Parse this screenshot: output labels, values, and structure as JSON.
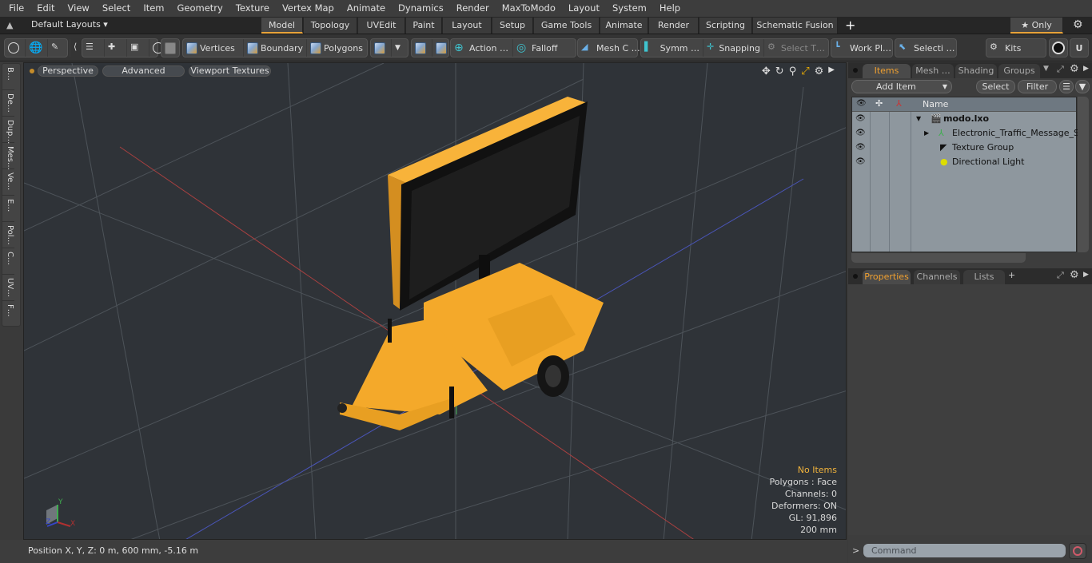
{
  "menu": [
    "File",
    "Edit",
    "View",
    "Select",
    "Item",
    "Geometry",
    "Texture",
    "Vertex Map",
    "Animate",
    "Dynamics",
    "Render",
    "MaxToModo",
    "Layout",
    "System",
    "Help"
  ],
  "layouts": {
    "label": "Default Layouts ▾",
    "tabs": [
      "Model",
      "Topology",
      "UVEdit",
      "Paint",
      "Layout",
      "Setup",
      "Game Tools",
      "Animate",
      "Render",
      "Scripting",
      "Schematic Fusion"
    ],
    "active": "Model",
    "add": "+",
    "only": "★ Only"
  },
  "toolbar": {
    "vertices": "Vertices",
    "boundary": "Boundary",
    "polygons": "Polygons",
    "action": "Action",
    "falloff": "Falloff",
    "mesh": "Mesh C …",
    "symm": "Symm …",
    "snapping": "Snapping",
    "select_t": "Select T…",
    "work_plane": "Work Pl…",
    "selection": "Selecti …",
    "kits": "Kits"
  },
  "left_tools": [
    "B…",
    "De…",
    "Dup…",
    "Mes…",
    "Ve…",
    "E…",
    "Pol…",
    "C…",
    "UV…",
    "F…"
  ],
  "viewport": {
    "perspective": "Perspective",
    "advanced": "Advanced",
    "textures": "Viewport Textures",
    "info": {
      "items": "No Items",
      "polygons": "Polygons : Face",
      "channels": "Channels: 0",
      "deformers": "Deformers: ON",
      "gl": "GL: 91,896",
      "scale": "200 mm"
    },
    "axis": {
      "y": "Y",
      "z": "Z",
      "x": "X"
    }
  },
  "status": {
    "position": "Position X, Y, Z:   0 m, 600 mm, -5.16 m"
  },
  "items_panel": {
    "tabs": [
      "Items",
      "Mesh …",
      "Shading",
      "Groups"
    ],
    "active": "Items",
    "add_item": "Add Item",
    "select": "Select",
    "filter": "Filter",
    "name_col": "Name",
    "rows": [
      {
        "label": "modo.lxo",
        "bold": true
      },
      {
        "label": "Electronic_Traffic_Message_S…"
      },
      {
        "label": "Texture Group"
      },
      {
        "label": "Directional Light"
      }
    ]
  },
  "properties_panel": {
    "tabs": [
      "Properties",
      "Channels",
      "Lists"
    ],
    "active": "Properties",
    "add": "+"
  },
  "command": {
    "prompt": ">",
    "placeholder": "Command"
  },
  "colors": {
    "accent": "#e8a33a",
    "model": "#f4a92a"
  }
}
